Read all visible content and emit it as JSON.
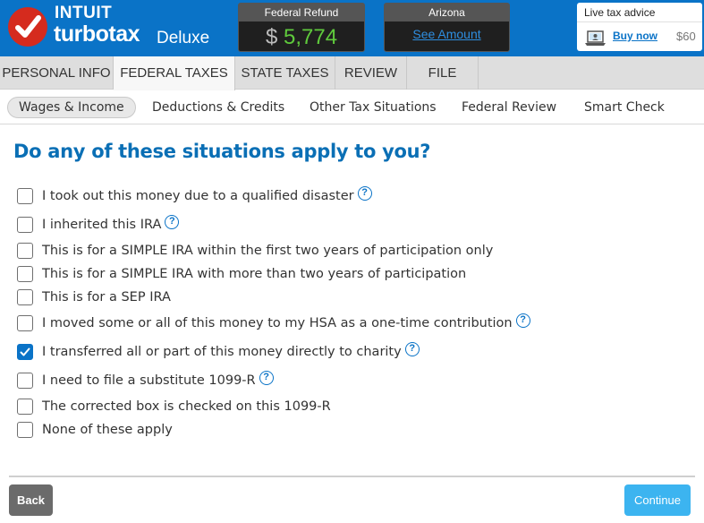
{
  "brand": {
    "company": "INTUIT",
    "product": "turbotax",
    "edition": "Deluxe"
  },
  "refunds": {
    "federal": {
      "title": "Federal Refund",
      "currency": "$",
      "amount": "5,774"
    },
    "state": {
      "title": "Arizona",
      "link": "See Amount"
    }
  },
  "advice": {
    "title": "Live tax advice",
    "buy_label": "Buy now",
    "price": "$60"
  },
  "main_tabs": [
    {
      "label": "PERSONAL INFO",
      "active": false
    },
    {
      "label": "FEDERAL TAXES",
      "active": true
    },
    {
      "label": "STATE TAXES",
      "active": false
    },
    {
      "label": "REVIEW",
      "active": false
    },
    {
      "label": "FILE",
      "active": false
    }
  ],
  "sub_tabs": [
    {
      "label": "Wages & Income",
      "active": true
    },
    {
      "label": "Deductions & Credits",
      "active": false
    },
    {
      "label": "Other Tax Situations",
      "active": false
    },
    {
      "label": "Federal Review",
      "active": false
    },
    {
      "label": "Smart Check",
      "active": false
    }
  ],
  "question": "Do any of these situations apply to you?",
  "options": [
    {
      "label": "I took out this money due to a qualified disaster",
      "checked": false,
      "help": true
    },
    {
      "label": "I inherited this IRA",
      "checked": false,
      "help": true
    },
    {
      "label": "This is for a SIMPLE IRA within the first two years of participation only",
      "checked": false,
      "help": false
    },
    {
      "label": "This is for a SIMPLE IRA with more than two years of participation",
      "checked": false,
      "help": false
    },
    {
      "label": "This is for a SEP IRA",
      "checked": false,
      "help": false
    },
    {
      "label": "I moved some or all of this money to my HSA as a one-time contribution",
      "checked": false,
      "help": true
    },
    {
      "label": "I transferred all or part of this money directly to charity",
      "checked": true,
      "help": true
    },
    {
      "label": "I need to file a substitute 1099-R",
      "checked": false,
      "help": true
    },
    {
      "label": "The corrected box is checked on this 1099-R",
      "checked": false,
      "help": false
    },
    {
      "label": "None of these apply",
      "checked": false,
      "help": false
    }
  ],
  "help_glyph": "?",
  "buttons": {
    "back": "Back",
    "continue": "Continue"
  },
  "colors": {
    "header": "#0a73c7",
    "accent": "#0a6fb5",
    "refund_green": "#5fca3c",
    "continue": "#3cb4f0",
    "back": "#6b6b6b"
  }
}
